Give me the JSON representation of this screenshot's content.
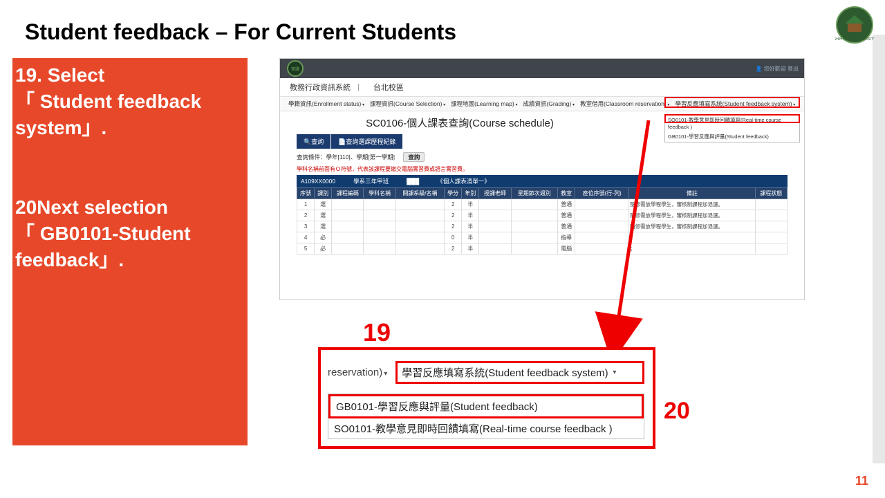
{
  "title": "Student feedback – For Current Students",
  "page_number": "11",
  "instructions": {
    "step19": "19. Select\n「 Student feedback system」.",
    "step20": "20Next selection\n「 GB0101-Student feedback」."
  },
  "annotations": {
    "label19": "19",
    "label20": "20"
  },
  "screenshot": {
    "topbar_user": "👤 您好歡迎 登出",
    "breadcrumb": {
      "sys": "教務行政資訊系統",
      "campus": "台北校區"
    },
    "menu": [
      "學籍資訊(Enrollment status)",
      "課程資訊(Course Selection)",
      "課程地圖(Learning map)",
      "成績資訊(Grading)",
      "教室借用(Classroom reservation)",
      "學習反應填寫系統(Student feedback system)"
    ],
    "dropdown_small": {
      "opt1": "SO0101-教學意見即時回饋填寫(Real-time course feedback )",
      "opt2": "GB0101-學習反應與評量(Student feedback)"
    },
    "heading": "SC0106-個人課表查詢(Course schedule)",
    "tabs": {
      "search": "🔍查詢",
      "history": "📄查詢選課歷程紀錄"
    },
    "query_line": {
      "prefix": "查詢條件：學年[110]、學期[第一學期]",
      "btn": "查詢"
    },
    "red_warning": "學科名稱前面有Ｏ符號，代表該課程要繳交電腦實習費或語言實習費。",
    "strip": {
      "id": "A109XX0000",
      "class": "學系三年甲班",
      "name": "███",
      "note": "《個人課表清單一》"
    },
    "columns": [
      "序號",
      "課別",
      "課程編碼",
      "學科名稱",
      "開課系級/名稱",
      "學分",
      "年別",
      "授課老師",
      "星期節次週別",
      "教室",
      "座位序號(行-列)",
      "備註",
      "課程狀態"
    ],
    "rows": [
      {
        "n": "1",
        "t": "選",
        "cr": "2",
        "y": "半",
        "rm": "普通",
        "note": "隨修需放學程學生，審核制課程加退選。"
      },
      {
        "n": "2",
        "t": "選",
        "cr": "2",
        "y": "半",
        "rm": "普通",
        "note": "隨修需放學程學生，審核制課程加退選。"
      },
      {
        "n": "3",
        "t": "選",
        "cr": "2",
        "y": "半",
        "rm": "普通",
        "note": "隨修需放學程學生，審核制課程加退選。"
      },
      {
        "n": "4",
        "t": "必",
        "cr": "0",
        "y": "半",
        "rm": "指導",
        "note": "；"
      },
      {
        "n": "5",
        "t": "必",
        "cr": "2",
        "y": "半",
        "rm": "電腦",
        "note": "；"
      }
    ]
  },
  "callout": {
    "reservation": "reservation)",
    "menu_item": "學習反應填寫系統(Student feedback system)",
    "opt1": "GB0101-學習反應與評量(Student feedback)",
    "opt2": "SO0101-教學意見即時回饋填寫(Real-time course feedback )"
  }
}
